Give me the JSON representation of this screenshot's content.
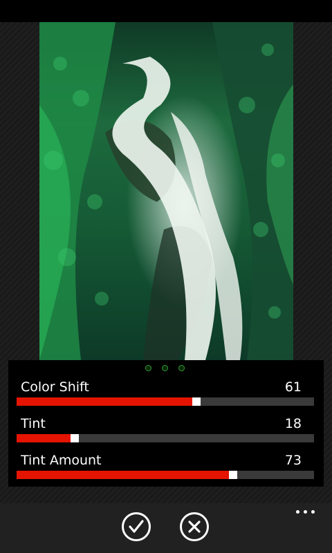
{
  "pager": {
    "dots": 3
  },
  "sliders": [
    {
      "label": "Color Shift",
      "value": "61",
      "fraction": 0.605
    },
    {
      "label": "Tint",
      "value": "18",
      "fraction": 0.195
    },
    {
      "label": "Tint Amount",
      "value": "73",
      "fraction": 0.727
    }
  ],
  "colors": {
    "accent": "#e51400",
    "track": "#3a3a3a",
    "thumb": "#ffffff",
    "pager": "#2f9b2f"
  },
  "appbar": {
    "buttons": [
      "check-icon",
      "close-icon"
    ],
    "more": "more-icon"
  }
}
